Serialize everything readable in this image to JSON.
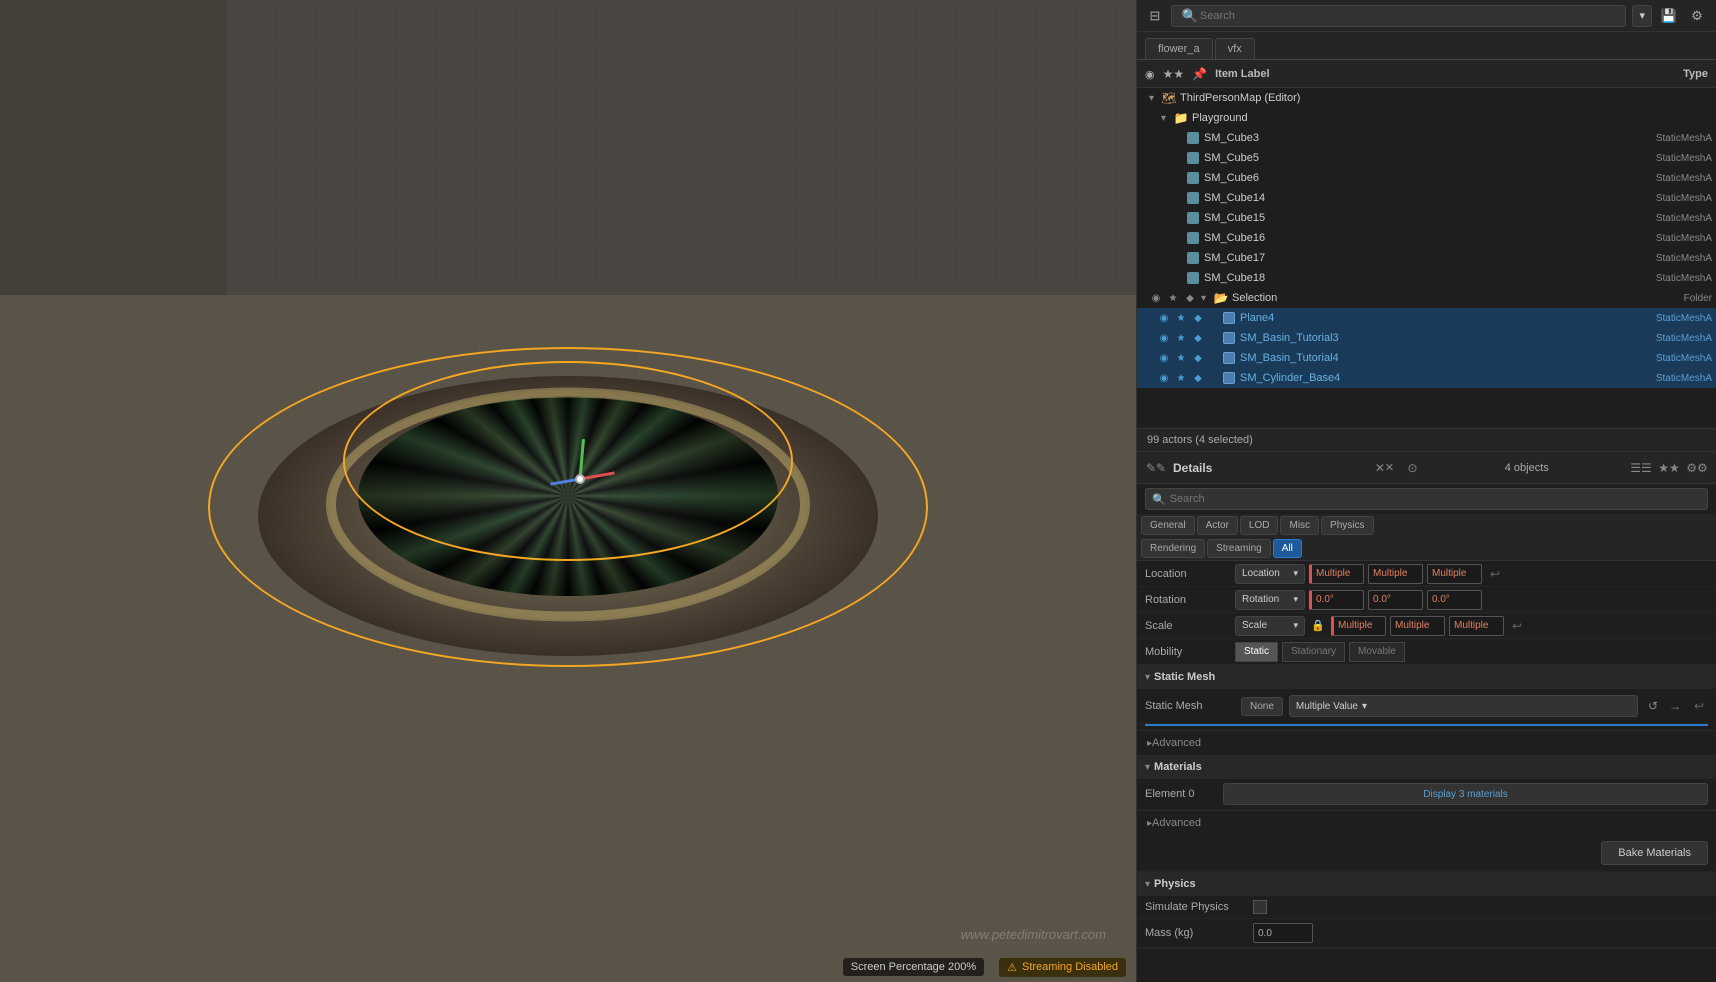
{
  "toolbar": {
    "search_placeholder": "Search",
    "filter_icon": "⊟",
    "settings_icon": "⚙",
    "save_icon": "💾",
    "dropdown_icon": "▾"
  },
  "tabs": [
    {
      "label": "flower_a",
      "active": false
    },
    {
      "label": "vfx",
      "active": false
    }
  ],
  "outliner": {
    "columns": {
      "label": "Item Label",
      "type": "Type"
    },
    "tree": [
      {
        "id": "map-root",
        "label": "ThirdPersonMap (Editor)",
        "indent": 0,
        "type": "",
        "icon": "map",
        "expanded": true
      },
      {
        "id": "playground",
        "label": "Playground",
        "indent": 1,
        "type": "",
        "icon": "folder",
        "expanded": true
      },
      {
        "id": "sm-cube3",
        "label": "SM_Cube3",
        "indent": 2,
        "type": "StaticMeshA",
        "icon": "mesh"
      },
      {
        "id": "sm-cube5",
        "label": "SM_Cube5",
        "indent": 2,
        "type": "StaticMeshA",
        "icon": "mesh"
      },
      {
        "id": "sm-cube6",
        "label": "SM_Cube6",
        "indent": 2,
        "type": "StaticMeshA",
        "icon": "mesh"
      },
      {
        "id": "sm-cube14",
        "label": "SM_Cube14",
        "indent": 2,
        "type": "StaticMeshA",
        "icon": "mesh"
      },
      {
        "id": "sm-cube15",
        "label": "SM_Cube15",
        "indent": 2,
        "type": "StaticMeshA",
        "icon": "mesh"
      },
      {
        "id": "sm-cube16",
        "label": "SM_Cube16",
        "indent": 2,
        "type": "StaticMeshA",
        "icon": "mesh"
      },
      {
        "id": "sm-cube17",
        "label": "SM_Cube17",
        "indent": 2,
        "type": "StaticMeshA",
        "icon": "mesh"
      },
      {
        "id": "sm-cube18",
        "label": "SM_Cube18",
        "indent": 2,
        "type": "StaticMeshA",
        "icon": "mesh"
      },
      {
        "id": "selection",
        "label": "Selection",
        "indent": 1,
        "type": "Folder",
        "icon": "folder-sel",
        "expanded": true
      },
      {
        "id": "plane4",
        "label": "Plane4",
        "indent": 2,
        "type": "StaticMeshA",
        "icon": "mesh-sel",
        "selected": true
      },
      {
        "id": "sm-basin3",
        "label": "SM_Basin_Tutorial3",
        "indent": 2,
        "type": "StaticMeshA",
        "icon": "mesh-sel",
        "selected": true
      },
      {
        "id": "sm-basin4",
        "label": "SM_Basin_Tutorial4",
        "indent": 2,
        "type": "StaticMeshA",
        "icon": "mesh-sel",
        "selected": true
      },
      {
        "id": "sm-cylinder4",
        "label": "SM_Cylinder_Base4",
        "indent": 2,
        "type": "StaticMeshA",
        "icon": "mesh-sel",
        "selected": true
      }
    ],
    "selection_info": "99 actors (4 selected)"
  },
  "details": {
    "title": "Details",
    "count": "4 objects",
    "search_placeholder": "Search",
    "tabs_row1": [
      "General",
      "Actor",
      "LOD",
      "Misc",
      "Physics"
    ],
    "tabs_row2": [
      "Rendering",
      "Streaming",
      "All"
    ],
    "active_tab": "All",
    "properties": {
      "location_label": "Location",
      "location_values": [
        "Multiple",
        "Multiple",
        "Multiple"
      ],
      "rotation_label": "Rotation",
      "rotation_values": [
        "0.0°",
        "0.0°",
        "0.0°"
      ],
      "scale_label": "Scale",
      "scale_values": [
        "Multiple",
        "Multiple",
        "Multiple"
      ],
      "mobility_label": "Mobility",
      "mobility_btns": [
        "Static",
        "Stationary",
        "Movable"
      ]
    },
    "static_mesh_section": {
      "title": "Static Mesh",
      "label": "Static Mesh",
      "none_btn": "None",
      "value": "Multiple Value",
      "refresh_icon": "↺",
      "forward_icon": "→"
    },
    "advanced_label": "Advanced",
    "materials": {
      "title": "Materials",
      "element0_label": "Element 0",
      "element0_value": "Display 3 materials"
    },
    "advanced2_label": "Advanced",
    "bake_btn": "Bake Materials",
    "physics": {
      "title": "Physics",
      "simulate_label": "Simulate Physics",
      "mass_label": "Mass (kg)",
      "mass_value": "0.0"
    }
  },
  "statusbar": {
    "screen_pct": "Screen Percentage  200%",
    "streaming_label": "Streaming Disabled",
    "warning_icon": "⚠"
  },
  "watermark": "www.petedimitrovart.com"
}
